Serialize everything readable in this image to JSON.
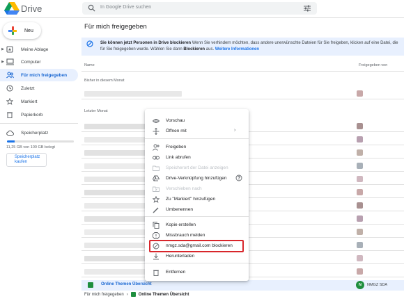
{
  "app": {
    "name": "Drive"
  },
  "search": {
    "placeholder": "In Google Drive suchen"
  },
  "sidebar": {
    "new_label": "Neu",
    "items": [
      {
        "label": "Meine Ablage",
        "icon": "my-drive-icon"
      },
      {
        "label": "Computer",
        "icon": "computer-icon"
      },
      {
        "label": "Für mich freigegeben",
        "icon": "shared-icon"
      },
      {
        "label": "Zuletzt",
        "icon": "clock-icon"
      },
      {
        "label": "Markiert",
        "icon": "star-icon"
      },
      {
        "label": "Papierkorb",
        "icon": "trash-icon"
      },
      {
        "label": "Speicherplatz",
        "icon": "cloud-icon"
      }
    ],
    "storage": {
      "used_text": "11,25 GB von 100 GB belegt",
      "fraction_used": 0.1125,
      "buy_label": "Speicherplatz kaufen"
    }
  },
  "main": {
    "title": "Für mich freigegeben",
    "banner": {
      "bold": "Sie können jetzt Personen in Drive blockieren",
      "text1": " Wenn Sie verhindern möchten, dass andere unerwünschte Dateien für Sie freigeben, klicken auf eine Datei, die für Sie freigegeben wurde. Wählen Sie dann ",
      "bold2": "Blockieren",
      "text2": " aus. ",
      "link": "Weitere Informationen"
    },
    "columns": {
      "name": "Name",
      "shared": "Freigegeben von"
    },
    "sections": [
      "Bisher in diesem Monat",
      "Letzter Monat"
    ],
    "selected_file": {
      "name": "Online Themen Übersicht",
      "owner_initial": "N",
      "owner": "NMGZ SDA"
    },
    "breadcrumb": {
      "root": "Für mich freigegeben",
      "current": "Online Themen Übersicht"
    }
  },
  "context_menu": {
    "items": [
      {
        "label": "Vorschau",
        "icon": "eye-icon",
        "enabled": true
      },
      {
        "label": "Öffnen mit",
        "icon": "move-arrows-icon",
        "enabled": true,
        "submenu": true
      },
      {
        "label": "Freigeben",
        "icon": "person-add-icon",
        "enabled": true
      },
      {
        "label": "Link abrufen",
        "icon": "link-icon",
        "enabled": true
      },
      {
        "label": "Speicherort der Datei anzeigen",
        "icon": "folder-icon",
        "enabled": false
      },
      {
        "label": "Drive-Verknüpfung hinzufügen",
        "icon": "drive-shortcut-icon",
        "enabled": true,
        "help": true
      },
      {
        "label": "Verschieben nach",
        "icon": "folder-move-icon",
        "enabled": false
      },
      {
        "label": "Zu \"Markiert\" hinzufügen",
        "icon": "star-icon",
        "enabled": true
      },
      {
        "label": "Umbenennen",
        "icon": "pencil-icon",
        "enabled": true
      },
      {
        "label": "Kopie erstellen",
        "icon": "copy-icon",
        "enabled": true
      },
      {
        "label": "Missbrauch melden",
        "icon": "report-icon",
        "enabled": true
      },
      {
        "label": "nmgz.sda@gmail.com blockieren",
        "icon": "block-icon",
        "enabled": true
      },
      {
        "label": "Herunterladen",
        "icon": "download-icon",
        "enabled": true
      },
      {
        "label": "Entfernen",
        "icon": "trash-icon",
        "enabled": true
      }
    ]
  },
  "colors": {
    "accent": "#1a73e8",
    "highlight": "#d8262b",
    "active_bg": "#e8f0fe"
  }
}
